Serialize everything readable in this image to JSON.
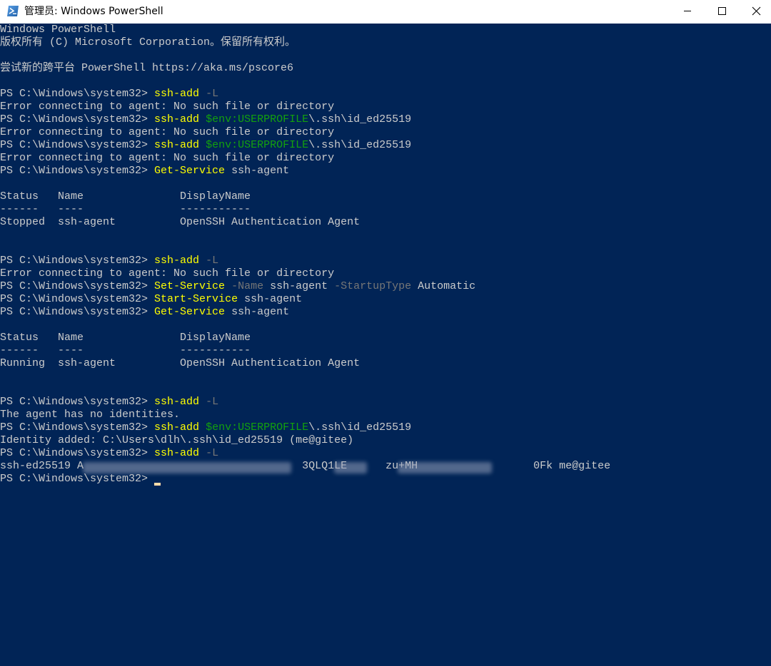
{
  "window": {
    "title": "管理员: Windows PowerShell",
    "controls": {
      "minimize": "minimize-icon",
      "maximize": "maximize-icon",
      "close": "close-icon"
    }
  },
  "colors": {
    "console_background": "#012456",
    "default_text": "#cccccc",
    "command": "#ffff00",
    "parameter": "#767676",
    "variable": "#13a10e",
    "cursor": "#fedba9"
  },
  "console": {
    "lines": [
      [
        {
          "t": "plain",
          "s": "Windows PowerShell"
        }
      ],
      [
        {
          "t": "plain",
          "s": "版权所有 (C) Microsoft Corporation。保留所有权利。"
        }
      ],
      [],
      [
        {
          "t": "plain",
          "s": "尝试新的跨平台 PowerShell https://aka.ms/pscore6"
        }
      ],
      [],
      [
        {
          "t": "plain",
          "s": "PS C:\\Windows\\system32> "
        },
        {
          "t": "cmd",
          "s": "ssh-add"
        },
        {
          "t": "plain",
          "s": " "
        },
        {
          "t": "param",
          "s": "-L"
        }
      ],
      [
        {
          "t": "plain",
          "s": "Error connecting to agent: No such file or directory"
        }
      ],
      [
        {
          "t": "plain",
          "s": "PS C:\\Windows\\system32> "
        },
        {
          "t": "cmd",
          "s": "ssh-add"
        },
        {
          "t": "plain",
          "s": " "
        },
        {
          "t": "var",
          "s": "$env:USERPROFILE"
        },
        {
          "t": "plain",
          "s": "\\.ssh\\id_ed25519"
        }
      ],
      [
        {
          "t": "plain",
          "s": "Error connecting to agent: No such file or directory"
        }
      ],
      [
        {
          "t": "plain",
          "s": "PS C:\\Windows\\system32> "
        },
        {
          "t": "cmd",
          "s": "ssh-add"
        },
        {
          "t": "plain",
          "s": " "
        },
        {
          "t": "var",
          "s": "$env:USERPROFILE"
        },
        {
          "t": "plain",
          "s": "\\.ssh\\id_ed25519"
        }
      ],
      [
        {
          "t": "plain",
          "s": "Error connecting to agent: No such file or directory"
        }
      ],
      [
        {
          "t": "plain",
          "s": "PS C:\\Windows\\system32> "
        },
        {
          "t": "cmd",
          "s": "Get-Service"
        },
        {
          "t": "plain",
          "s": " ssh-agent"
        }
      ],
      [],
      [
        {
          "t": "plain",
          "s": "Status   Name               DisplayName"
        }
      ],
      [
        {
          "t": "plain",
          "s": "------   ----               -----------"
        }
      ],
      [
        {
          "t": "plain",
          "s": "Stopped  ssh-agent          OpenSSH Authentication Agent"
        }
      ],
      [],
      [],
      [
        {
          "t": "plain",
          "s": "PS C:\\Windows\\system32> "
        },
        {
          "t": "cmd",
          "s": "ssh-add"
        },
        {
          "t": "plain",
          "s": " "
        },
        {
          "t": "param",
          "s": "-L"
        }
      ],
      [
        {
          "t": "plain",
          "s": "Error connecting to agent: No such file or directory"
        }
      ],
      [
        {
          "t": "plain",
          "s": "PS C:\\Windows\\system32> "
        },
        {
          "t": "cmd",
          "s": "Set-Service"
        },
        {
          "t": "plain",
          "s": " "
        },
        {
          "t": "param",
          "s": "-Name"
        },
        {
          "t": "plain",
          "s": " ssh-agent "
        },
        {
          "t": "param",
          "s": "-StartupType"
        },
        {
          "t": "plain",
          "s": " Automatic"
        }
      ],
      [
        {
          "t": "plain",
          "s": "PS C:\\Windows\\system32> "
        },
        {
          "t": "cmd",
          "s": "Start-Service"
        },
        {
          "t": "plain",
          "s": " ssh-agent"
        }
      ],
      [
        {
          "t": "plain",
          "s": "PS C:\\Windows\\system32> "
        },
        {
          "t": "cmd",
          "s": "Get-Service"
        },
        {
          "t": "plain",
          "s": " ssh-agent"
        }
      ],
      [],
      [
        {
          "t": "plain",
          "s": "Status   Name               DisplayName"
        }
      ],
      [
        {
          "t": "plain",
          "s": "------   ----               -----------"
        }
      ],
      [
        {
          "t": "plain",
          "s": "Running  ssh-agent          OpenSSH Authentication Agent"
        }
      ],
      [],
      [],
      [
        {
          "t": "plain",
          "s": "PS C:\\Windows\\system32> "
        },
        {
          "t": "cmd",
          "s": "ssh-add"
        },
        {
          "t": "plain",
          "s": " "
        },
        {
          "t": "param",
          "s": "-L"
        }
      ],
      [
        {
          "t": "plain",
          "s": "The agent has no identities."
        }
      ],
      [
        {
          "t": "plain",
          "s": "PS C:\\Windows\\system32> "
        },
        {
          "t": "cmd",
          "s": "ssh-add"
        },
        {
          "t": "plain",
          "s": " "
        },
        {
          "t": "var",
          "s": "$env:USERPROFILE"
        },
        {
          "t": "plain",
          "s": "\\.ssh\\id_ed25519"
        }
      ],
      [
        {
          "t": "plain",
          "s": "Identity added: C:\\Users\\dlh\\.ssh\\id_ed25519 (me@gitee)"
        }
      ],
      [
        {
          "t": "plain",
          "s": "PS C:\\Windows\\system32> "
        },
        {
          "t": "cmd",
          "s": "ssh-add"
        },
        {
          "t": "plain",
          "s": " "
        },
        {
          "t": "param",
          "s": "-L"
        }
      ],
      [
        {
          "t": "plain",
          "s": "ssh-ed25519 A                                  3QLQ1LE      zu+MH                  0Fk me@gitee"
        }
      ],
      [
        {
          "t": "plain",
          "s": "PS C:\\Windows\\system32> "
        }
      ]
    ]
  }
}
